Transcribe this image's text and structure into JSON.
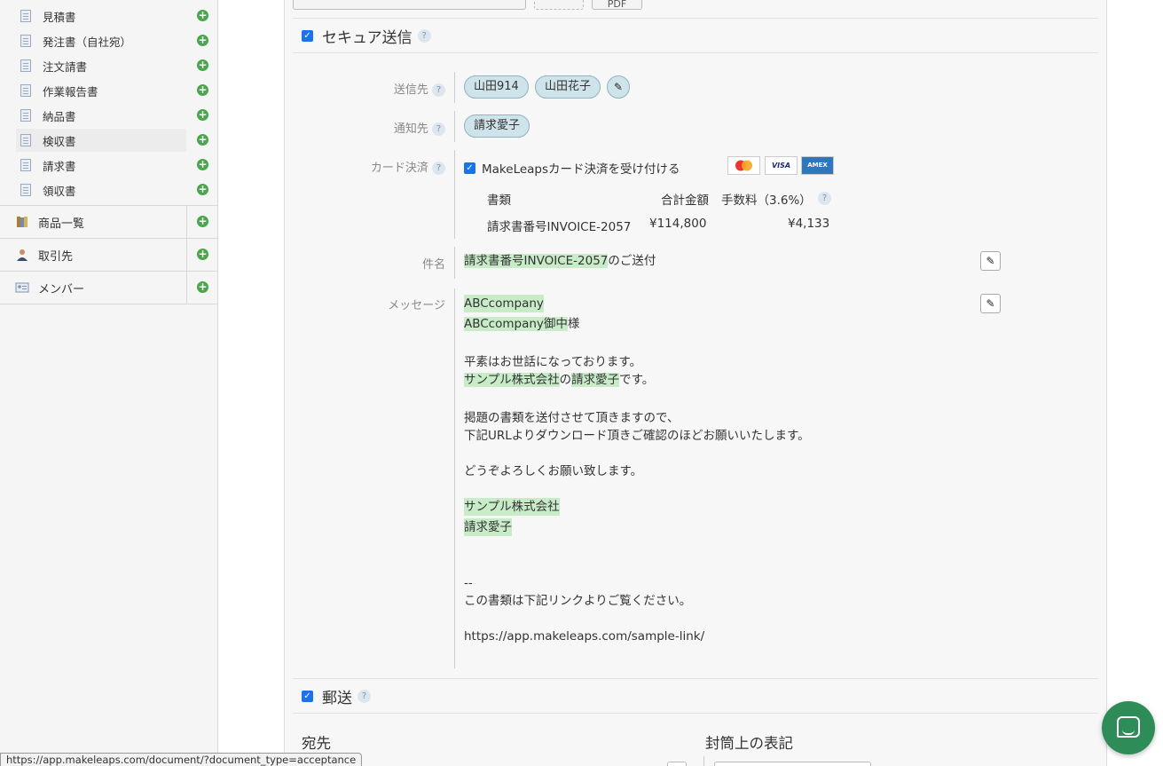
{
  "sidebar": {
    "documents": [
      {
        "label": "見積書"
      },
      {
        "label": "発注書（自社宛）"
      },
      {
        "label": "注文請書"
      },
      {
        "label": "作業報告書"
      },
      {
        "label": "納品書"
      },
      {
        "label": "検収書",
        "active": true
      },
      {
        "label": "請求書"
      },
      {
        "label": "領収書"
      }
    ],
    "sections": [
      {
        "label": "商品一覧",
        "icon": "book-icon"
      },
      {
        "label": "取引先",
        "icon": "person-icon"
      },
      {
        "label": "メンバー",
        "icon": "id-card-icon"
      }
    ],
    "add_symbol": "+"
  },
  "top_buttons": {
    "pdf_label": "PDF"
  },
  "secure_send": {
    "title": "セキュア送信",
    "help": "?",
    "recipients_label": "送信先",
    "recipients": [
      "山田914",
      "山田花子"
    ],
    "notify_label": "通知先",
    "notify": [
      "請求愛子"
    ],
    "card_label": "カード決済",
    "card_accept_label": "MakeLeapsカード決済を受け付ける",
    "card_brands": [
      "MasterCard",
      "VISA",
      "AMEX"
    ],
    "fee_table": {
      "col_document": "書類",
      "col_total": "合計金額",
      "col_fee": "手数料（3.6%）",
      "row_document": "請求書番号INVOICE-2057",
      "row_total": "¥114,800",
      "row_fee": "¥4,133"
    },
    "subject_label": "件名",
    "subject_var": "請求書番号INVOICE-2057",
    "subject_suffix": "のご送付",
    "message_label": "メッセージ",
    "message": {
      "company1": "ABCcompany",
      "company2": "ABCcompany御中",
      "honorific": "様",
      "line1": "平素はお世話になっております。",
      "sender_company": "サンプル株式会社",
      "no": "の",
      "sender_name": "請求愛子",
      "desu": "です。",
      "line2": "掲題の書類を送付させて頂きますので、",
      "line3": "下記URLよりダウンロード頂きご確認のほどお願いいたします。",
      "line4": "どうぞよろしくお願い致します。",
      "sig_company": "サンプル株式会社",
      "sig_name": "請求愛子",
      "dashes": "--",
      "line5": "この書類は下記リンクよりご覧ください。",
      "link": "https://app.makeleaps.com/sample-link/"
    }
  },
  "postal": {
    "title": "郵送",
    "help": "?",
    "address_heading": "宛先",
    "envelope_heading": "封筒上の表記"
  },
  "status_bar": {
    "url": "https://app.makeleaps.com/document/?document_type=acceptance"
  }
}
